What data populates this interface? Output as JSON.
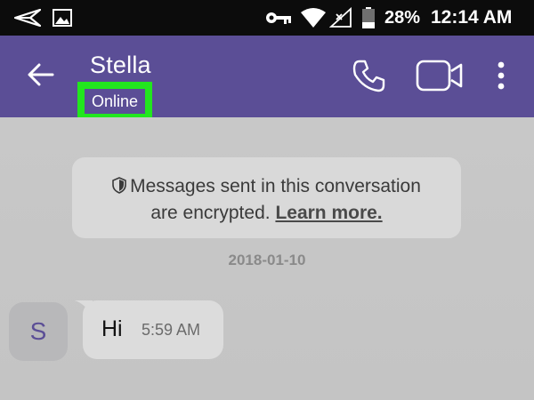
{
  "status_bar": {
    "battery_percent": "28%",
    "time": "12:14 AM",
    "icons": [
      "send-icon",
      "image-icon",
      "vpn-key-icon",
      "wifi-icon",
      "signal-icon",
      "battery-icon"
    ]
  },
  "header": {
    "contact_name": "Stella",
    "presence": "Online",
    "highlight_color": "#22e61e",
    "background_color": "#5b4e96",
    "icons": [
      "back-arrow-icon",
      "phone-icon",
      "video-camera-icon",
      "more-vert-icon"
    ]
  },
  "conversation": {
    "encryption_notice": {
      "line1": "Messages sent in this conversation",
      "line2": "are encrypted.",
      "link": "Learn more.",
      "icon": "shield-icon"
    },
    "date_separator": "2018-01-10",
    "messages": [
      {
        "avatar_initial": "S",
        "text": "Hi",
        "time": "5:59 AM"
      }
    ]
  }
}
